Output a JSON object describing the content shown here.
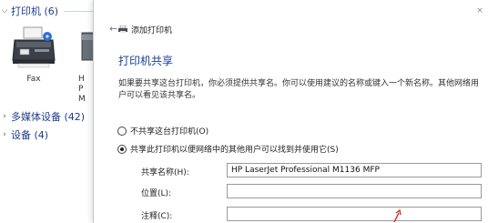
{
  "background": {
    "groups": {
      "printers": "打印机 (6)",
      "multimedia": "多媒体设备 (42)",
      "devices": "设备 (4)"
    },
    "fax_label": "Fax",
    "next_device_fragments": [
      "H",
      "P",
      "M"
    ]
  },
  "dialog": {
    "wizard_title": "添加打印机",
    "section_title": "打印机共享",
    "description": "如果要共享这台打印机，你必须提供共享名。你可以使用建议的名称或键入一个新名称。其他网络用户可以看见该共享名。",
    "options": {
      "no_share": "不共享这台打印机(O)",
      "share": "共享此打印机以便网络中的其他用户可以找到并使用它(S)"
    },
    "fields": {
      "share_name": {
        "label": "共享名称(H):",
        "value": "HP LaserJet Professional M1136 MFP"
      },
      "location": {
        "label": "位置(L):",
        "value": ""
      },
      "comment": {
        "label": "注释(C):",
        "value": ""
      }
    }
  },
  "colors": {
    "heading_blue": "#1b3f94",
    "annotation_red": "#d9302b"
  },
  "icons": [
    "fax-printer-icon",
    "back-arrow-icon",
    "printer-icon",
    "close-icon",
    "chevron-down-icon",
    "chevron-right-icon"
  ]
}
